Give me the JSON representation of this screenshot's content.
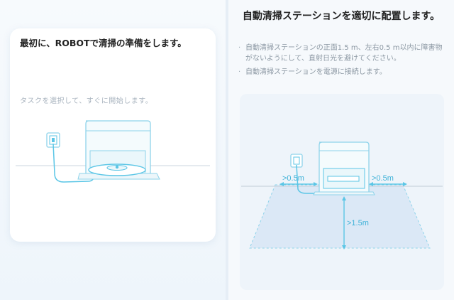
{
  "left": {
    "title": "最初に、ROBOTで清掃の準備をします。",
    "subtitle": "タスクを選択して、すぐに開始します。"
  },
  "right": {
    "title": "自動清掃ステーションを適切に配置します。",
    "bullets": [
      "自動清掃ステーションの正面1.5 m、左右0.5 m以内に障害物がないようにして、直射日光を避けてください。",
      "自動清掃ステーションを電源に接続します。"
    ],
    "illustration": {
      "left_clearance": ">0.5m",
      "right_clearance": ">0.5m",
      "front_clearance": ">1.5m"
    }
  },
  "colors": {
    "accent": "#5bc6e6",
    "line": "#8ed3ea",
    "floor": "#dbe8f6"
  }
}
